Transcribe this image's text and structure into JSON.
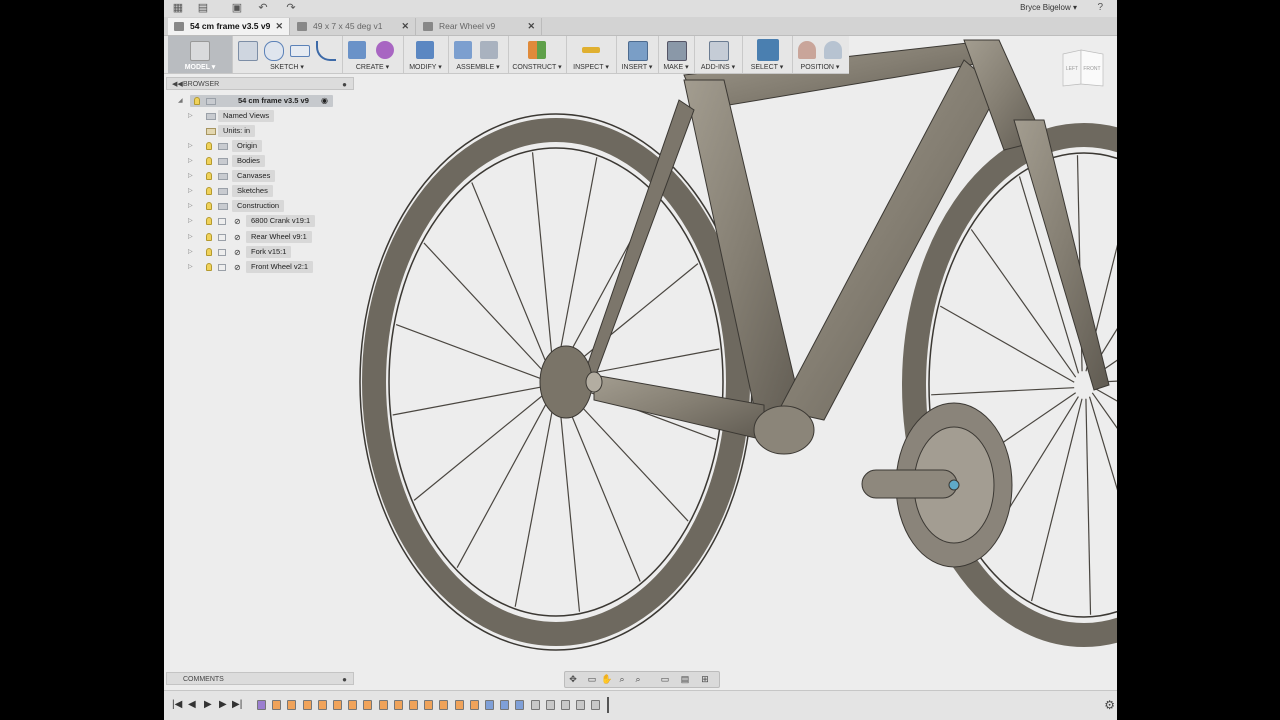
{
  "topbar": {
    "icons": [
      "grid-icon",
      "file-icon",
      "save-icon",
      "undo-icon",
      "redo-icon"
    ],
    "user": "Bryce Bigelow ▾",
    "help": "?"
  },
  "tabs": [
    {
      "label": "54 cm frame v3.5 v9",
      "active": true
    },
    {
      "label": "49 x 7 x 45 deg v1",
      "active": false
    },
    {
      "label": "Rear Wheel v9",
      "active": false
    }
  ],
  "toolbar": {
    "model": "MODEL ▾",
    "groups": [
      "SKETCH ▾",
      "CREATE ▾",
      "MODIFY ▾",
      "ASSEMBLE ▾",
      "CONSTRUCT ▾",
      "INSPECT ▾",
      "INSERT ▾",
      "MAKE ▾",
      "ADD-INS ▾",
      "SELECT ▾",
      "POSITION ▾"
    ]
  },
  "viewcube": {
    "left": "LEFT",
    "front": "FRONT"
  },
  "browser": {
    "title": "BROWSER",
    "root": "54 cm frame v3.5 v9",
    "items": [
      {
        "label": "Named Views"
      },
      {
        "label": "Units: in"
      },
      {
        "label": "Origin"
      },
      {
        "label": "Bodies"
      },
      {
        "label": "Canvases"
      },
      {
        "label": "Sketches"
      },
      {
        "label": "Construction"
      },
      {
        "label": "6800 Crank v19:1"
      },
      {
        "label": "Rear Wheel v9:1"
      },
      {
        "label": "Fork v15:1"
      },
      {
        "label": "Front Wheel v2:1"
      }
    ]
  },
  "comments": {
    "title": "COMMENTS"
  },
  "timeline": {
    "controls": [
      "|◀",
      "◀",
      "▶",
      "▶",
      "▶|"
    ]
  },
  "colors": {
    "frame": "#8a8478",
    "accent": "#4a7fb0",
    "bulb": "#f0d25a"
  }
}
